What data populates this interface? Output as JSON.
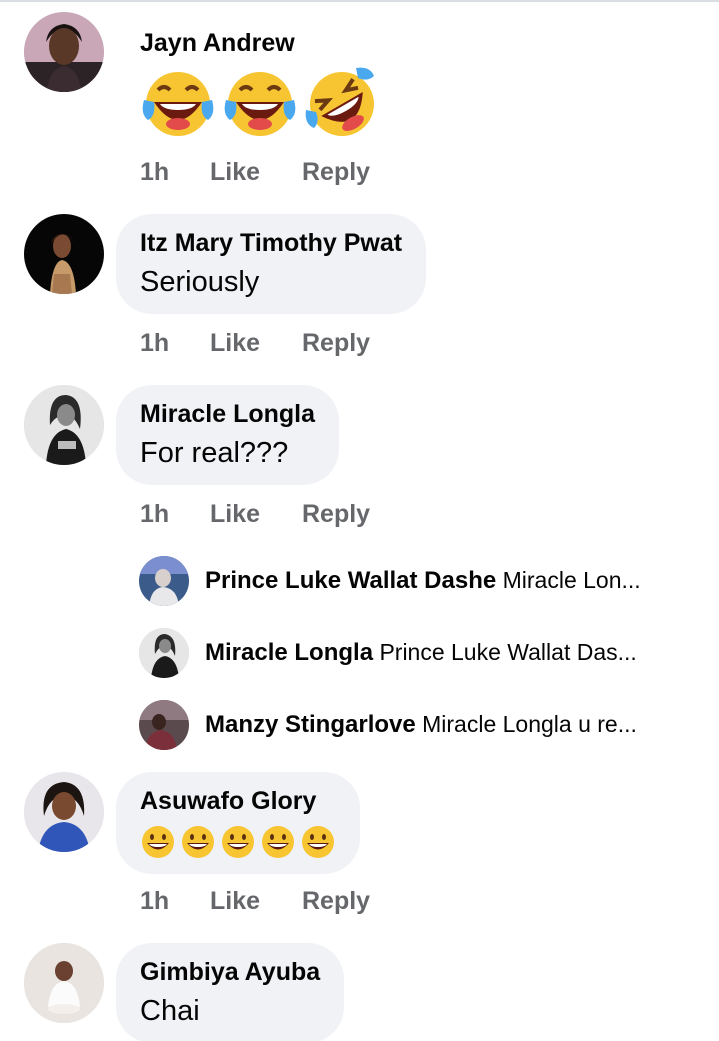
{
  "comments": [
    {
      "author": "Jayn Andrew",
      "emojis": [
        "tears-of-joy-emoji",
        "tears-of-joy-emoji",
        "rolling-laughing-emoji"
      ],
      "time": "1h",
      "like": "Like",
      "reply": "Reply"
    },
    {
      "author": "Itz Mary Timothy Pwat",
      "text": "Seriously",
      "time": "1h",
      "like": "Like",
      "reply": "Reply"
    },
    {
      "author": "Miracle Longla",
      "text": "For real???",
      "time": "1h",
      "like": "Like",
      "reply": "Reply",
      "replies": [
        {
          "author": "Prince Luke Wallat Dashe",
          "preview": "Miracle Lon..."
        },
        {
          "author": "Miracle Longla",
          "preview": "Prince Luke Wallat Das..."
        },
        {
          "author": "Manzy Stingarlove",
          "preview": "Miracle Longla  u re..."
        }
      ]
    },
    {
      "author": "Asuwafo Glory",
      "emojis": [
        "grinning-emoji",
        "grinning-emoji",
        "grinning-emoji",
        "grinning-emoji",
        "grinning-emoji"
      ],
      "time": "1h",
      "like": "Like",
      "reply": "Reply"
    },
    {
      "author": "Gimbiya Ayuba",
      "text": "Chai"
    }
  ],
  "colors": {
    "bubble": "#f0f2f5",
    "meta": "#65676b",
    "text": "#050505"
  }
}
